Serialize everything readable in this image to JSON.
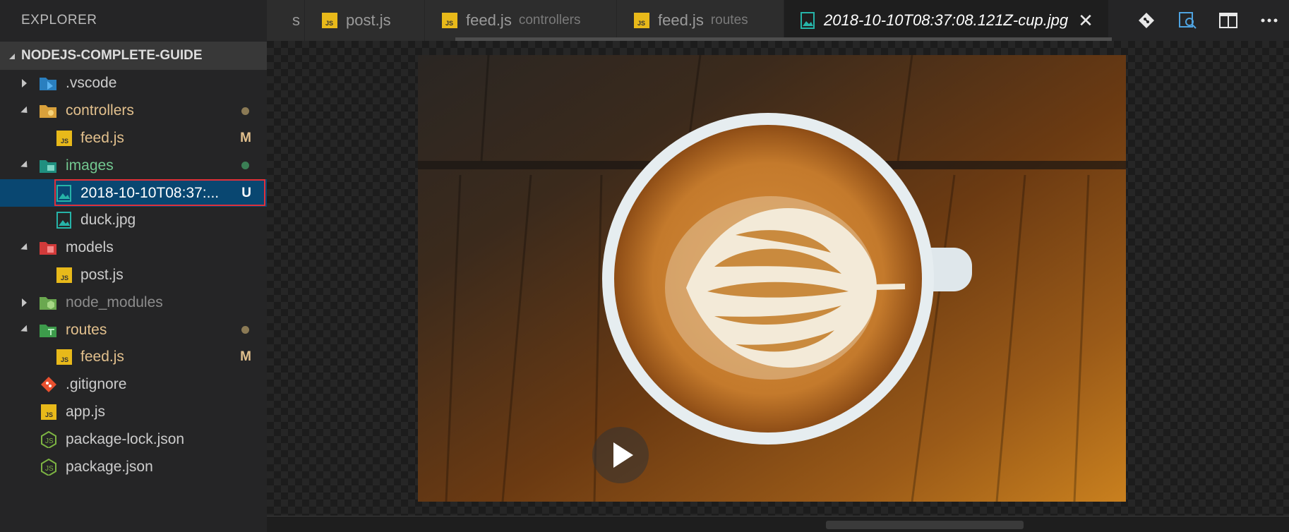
{
  "sidebar": {
    "title": "EXPLORER",
    "section": "NODEJS-COMPLETE-GUIDE",
    "items": [
      {
        "label": ".vscode",
        "color": "#cccccc"
      },
      {
        "label": "controllers",
        "color": "#e2c08d"
      },
      {
        "label": "feed.js",
        "color": "#e2c08d",
        "badge": "M"
      },
      {
        "label": "images",
        "color": "#73c991"
      },
      {
        "label": "2018-10-10T08:37:...",
        "color": "#ffffff",
        "badge": "U"
      },
      {
        "label": "duck.jpg",
        "color": "#cccccc"
      },
      {
        "label": "models",
        "color": "#cccccc"
      },
      {
        "label": "post.js",
        "color": "#cccccc"
      },
      {
        "label": "node_modules",
        "color": "#8c8c8c"
      },
      {
        "label": "routes",
        "color": "#e2c08d"
      },
      {
        "label": "feed.js",
        "color": "#e2c08d",
        "badge": "M"
      },
      {
        "label": ".gitignore",
        "color": "#cccccc"
      },
      {
        "label": "app.js",
        "color": "#cccccc"
      },
      {
        "label": "package-lock.json",
        "color": "#cccccc"
      },
      {
        "label": "package.json",
        "color": "#cccccc"
      }
    ]
  },
  "tabs": [
    {
      "label": "s",
      "desc": ""
    },
    {
      "label": "post.js",
      "desc": ""
    },
    {
      "label": "feed.js",
      "desc": "controllers"
    },
    {
      "label": "feed.js",
      "desc": "routes"
    },
    {
      "label": "2018-10-10T08:37:08.121Z-cup.jpg",
      "desc": ""
    }
  ],
  "icons": {
    "tab_close": "close-icon",
    "actions": [
      "git-compare-icon",
      "open-preview-icon",
      "split-editor-icon",
      "more-icon"
    ]
  },
  "colors": {
    "modified": "#e2c08d",
    "untracked": "#73c991",
    "selection": "#094771",
    "highlight_box": "#e0303a"
  }
}
